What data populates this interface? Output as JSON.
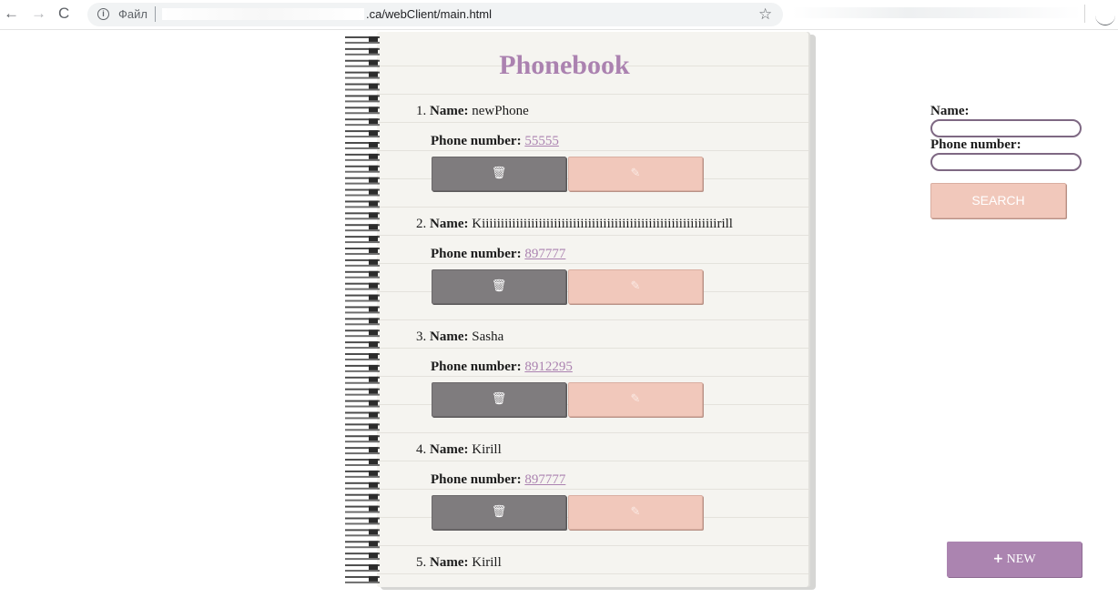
{
  "browser": {
    "back_icon": "←",
    "forward_icon": "→",
    "reload_icon": "C",
    "info_icon": "i",
    "scheme_label": "Файл",
    "url": ".ca/webClient/main.html",
    "star_icon": "☆"
  },
  "app": {
    "title": "Phonebook",
    "name_label": "Name:",
    "phone_label": "Phone number:",
    "delete_icon": "🗑",
    "edit_icon": "✎"
  },
  "contacts": [
    {
      "index": "1.",
      "name": "newPhone",
      "phone": "55555"
    },
    {
      "index": "2.",
      "name": "Kiiiiiiiiiiiiiiiiiiiiiiiiiiiiiiiiiiiiiiiiiiiiiiiiiiiiiiiiiiiiiirill",
      "phone": "897777"
    },
    {
      "index": "3.",
      "name": "Sasha",
      "phone": "8912295"
    },
    {
      "index": "4.",
      "name": "Kirill",
      "phone": "897777"
    },
    {
      "index": "5.",
      "name": "Kirill"
    }
  ],
  "search": {
    "name_label": "Name:",
    "phone_label": "Phone number:",
    "name_value": "",
    "phone_value": "",
    "button_label": "SEARCH"
  },
  "new_button": {
    "icon": "+",
    "label": "NEW"
  },
  "colors": {
    "accent": "#ab82b0",
    "delete_button": "#7f7c7e",
    "edit_button": "#f1c8bb",
    "input_border": "#7e6883"
  }
}
